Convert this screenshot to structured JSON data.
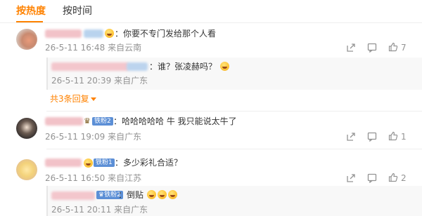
{
  "tabs": {
    "hot": "按热度",
    "time": "按时间"
  },
  "comments": [
    {
      "text": "：你要不专门发给那个人看",
      "time": "26-5-11 16:48",
      "location": "来自云南",
      "like_count": "7",
      "reply": {
        "text": "：谁？张凌赫吗？",
        "time": "26-5-11 20:39",
        "location": "来自广东"
      },
      "more_replies": "共3条回复"
    },
    {
      "badge": "铁粉2",
      "text": "：哈哈哈哈哈 牛 我只能说太牛了",
      "time": "26-5-11 19:09",
      "location": "来自广东",
      "like_count": "1"
    },
    {
      "badge": "铁粉1",
      "text": "：多少彩礼合适？",
      "time": "26-5-11 16:50",
      "location": "来自江苏",
      "like_count": "2",
      "reply": {
        "badge": "铁粉2",
        "text": "：倒贴",
        "time": "26-5-11 20:11",
        "location": "来自广东"
      }
    }
  ],
  "icons": {
    "share": "share-icon",
    "comment": "comment-icon",
    "like": "thumb-up-icon",
    "emoji": "laughing-emoji-icon",
    "caret": "caret-down-icon",
    "fan": "fan-crown-icon"
  },
  "colors": {
    "accent": "#ff8200",
    "meta": "#939393",
    "badge": "#5c8fd6"
  }
}
